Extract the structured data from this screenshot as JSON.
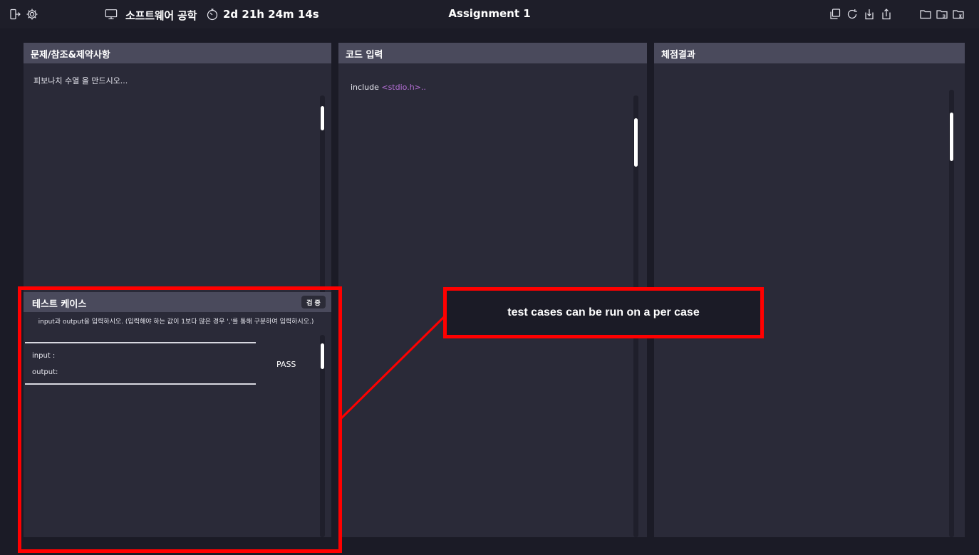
{
  "topbar": {
    "icons": [
      "exit-icon",
      "settings-gear-icon",
      "monitor-icon",
      "timer-icon",
      "copy-icon",
      "refresh-icon",
      "save-icon",
      "export-icon",
      "folder-1-icon",
      "folder-2-icon",
      "folder-3-icon"
    ],
    "course_name": "소프트웨어 공학",
    "time_remaining": "2d 21h 24m 14s",
    "title": "Assignment 1"
  },
  "panels": {
    "problem": {
      "header": "문제/참조&제약사항",
      "text": "피보나치 수열 을 만드시오..."
    },
    "code": {
      "header": "코드 입력",
      "code_keyword": "include ",
      "code_include": "<stdio.h>.."
    },
    "result": {
      "header": "체점결과"
    }
  },
  "testcase": {
    "header": "테스트 케이스",
    "verify_label": "검 증",
    "description": "input과 output을 입력하시오. (입력해야 하는 값이 1보다 많은 경우 ','를 통해 구분하여 입력하시오.)",
    "input_label": "input :",
    "output_label": "output:",
    "status": "PASS"
  },
  "annotation": {
    "text": "test cases can be run on a per case",
    "color": "#ff0000"
  },
  "colors": {
    "background": "#1b1b26",
    "panel": "#2a2a38",
    "panel_header": "#4a4a5c",
    "code_include": "#b56fd6"
  }
}
